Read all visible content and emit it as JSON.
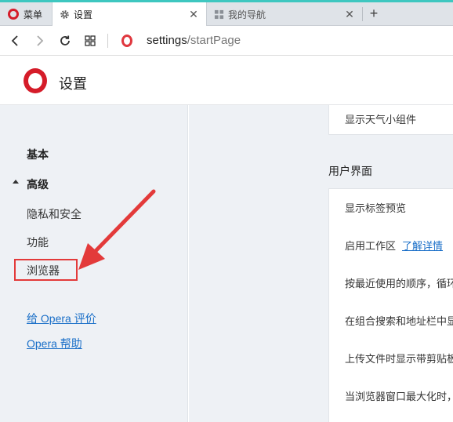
{
  "tabstrip": {
    "menu_label": "菜单",
    "tabs": [
      {
        "label": "设置",
        "icon": "gear-icon",
        "active": true
      },
      {
        "label": "我的导航",
        "icon": "grid-icon",
        "active": false
      }
    ],
    "new_tab": "+"
  },
  "address": {
    "url_host": "settings",
    "url_path": "/startPage"
  },
  "header": {
    "title": "设置"
  },
  "sidebar": {
    "items": [
      {
        "label": "基本"
      },
      {
        "label": "高级"
      },
      {
        "label": "隐私和安全"
      },
      {
        "label": "功能"
      },
      {
        "label": "浏览器"
      }
    ],
    "links": [
      {
        "label": "给 Opera 评价"
      },
      {
        "label": "Opera 帮助"
      }
    ]
  },
  "main": {
    "top_card_text": "显示天气小组件",
    "section_title": "用户界面",
    "rows": [
      {
        "text": "显示标签预览"
      },
      {
        "text": "启用工作区",
        "link": "了解详情"
      },
      {
        "text": "按最近使用的顺序，循环切"
      },
      {
        "text": "在组合搜索和地址栏中显示"
      },
      {
        "text": "上传文件时显示带剪贴板内"
      },
      {
        "text": "当浏览器窗口最大化时，"
      }
    ]
  },
  "annotation_color": "#e33a3a",
  "brand_color": "#d51c29",
  "accent_line_color": "#3ec7c0"
}
